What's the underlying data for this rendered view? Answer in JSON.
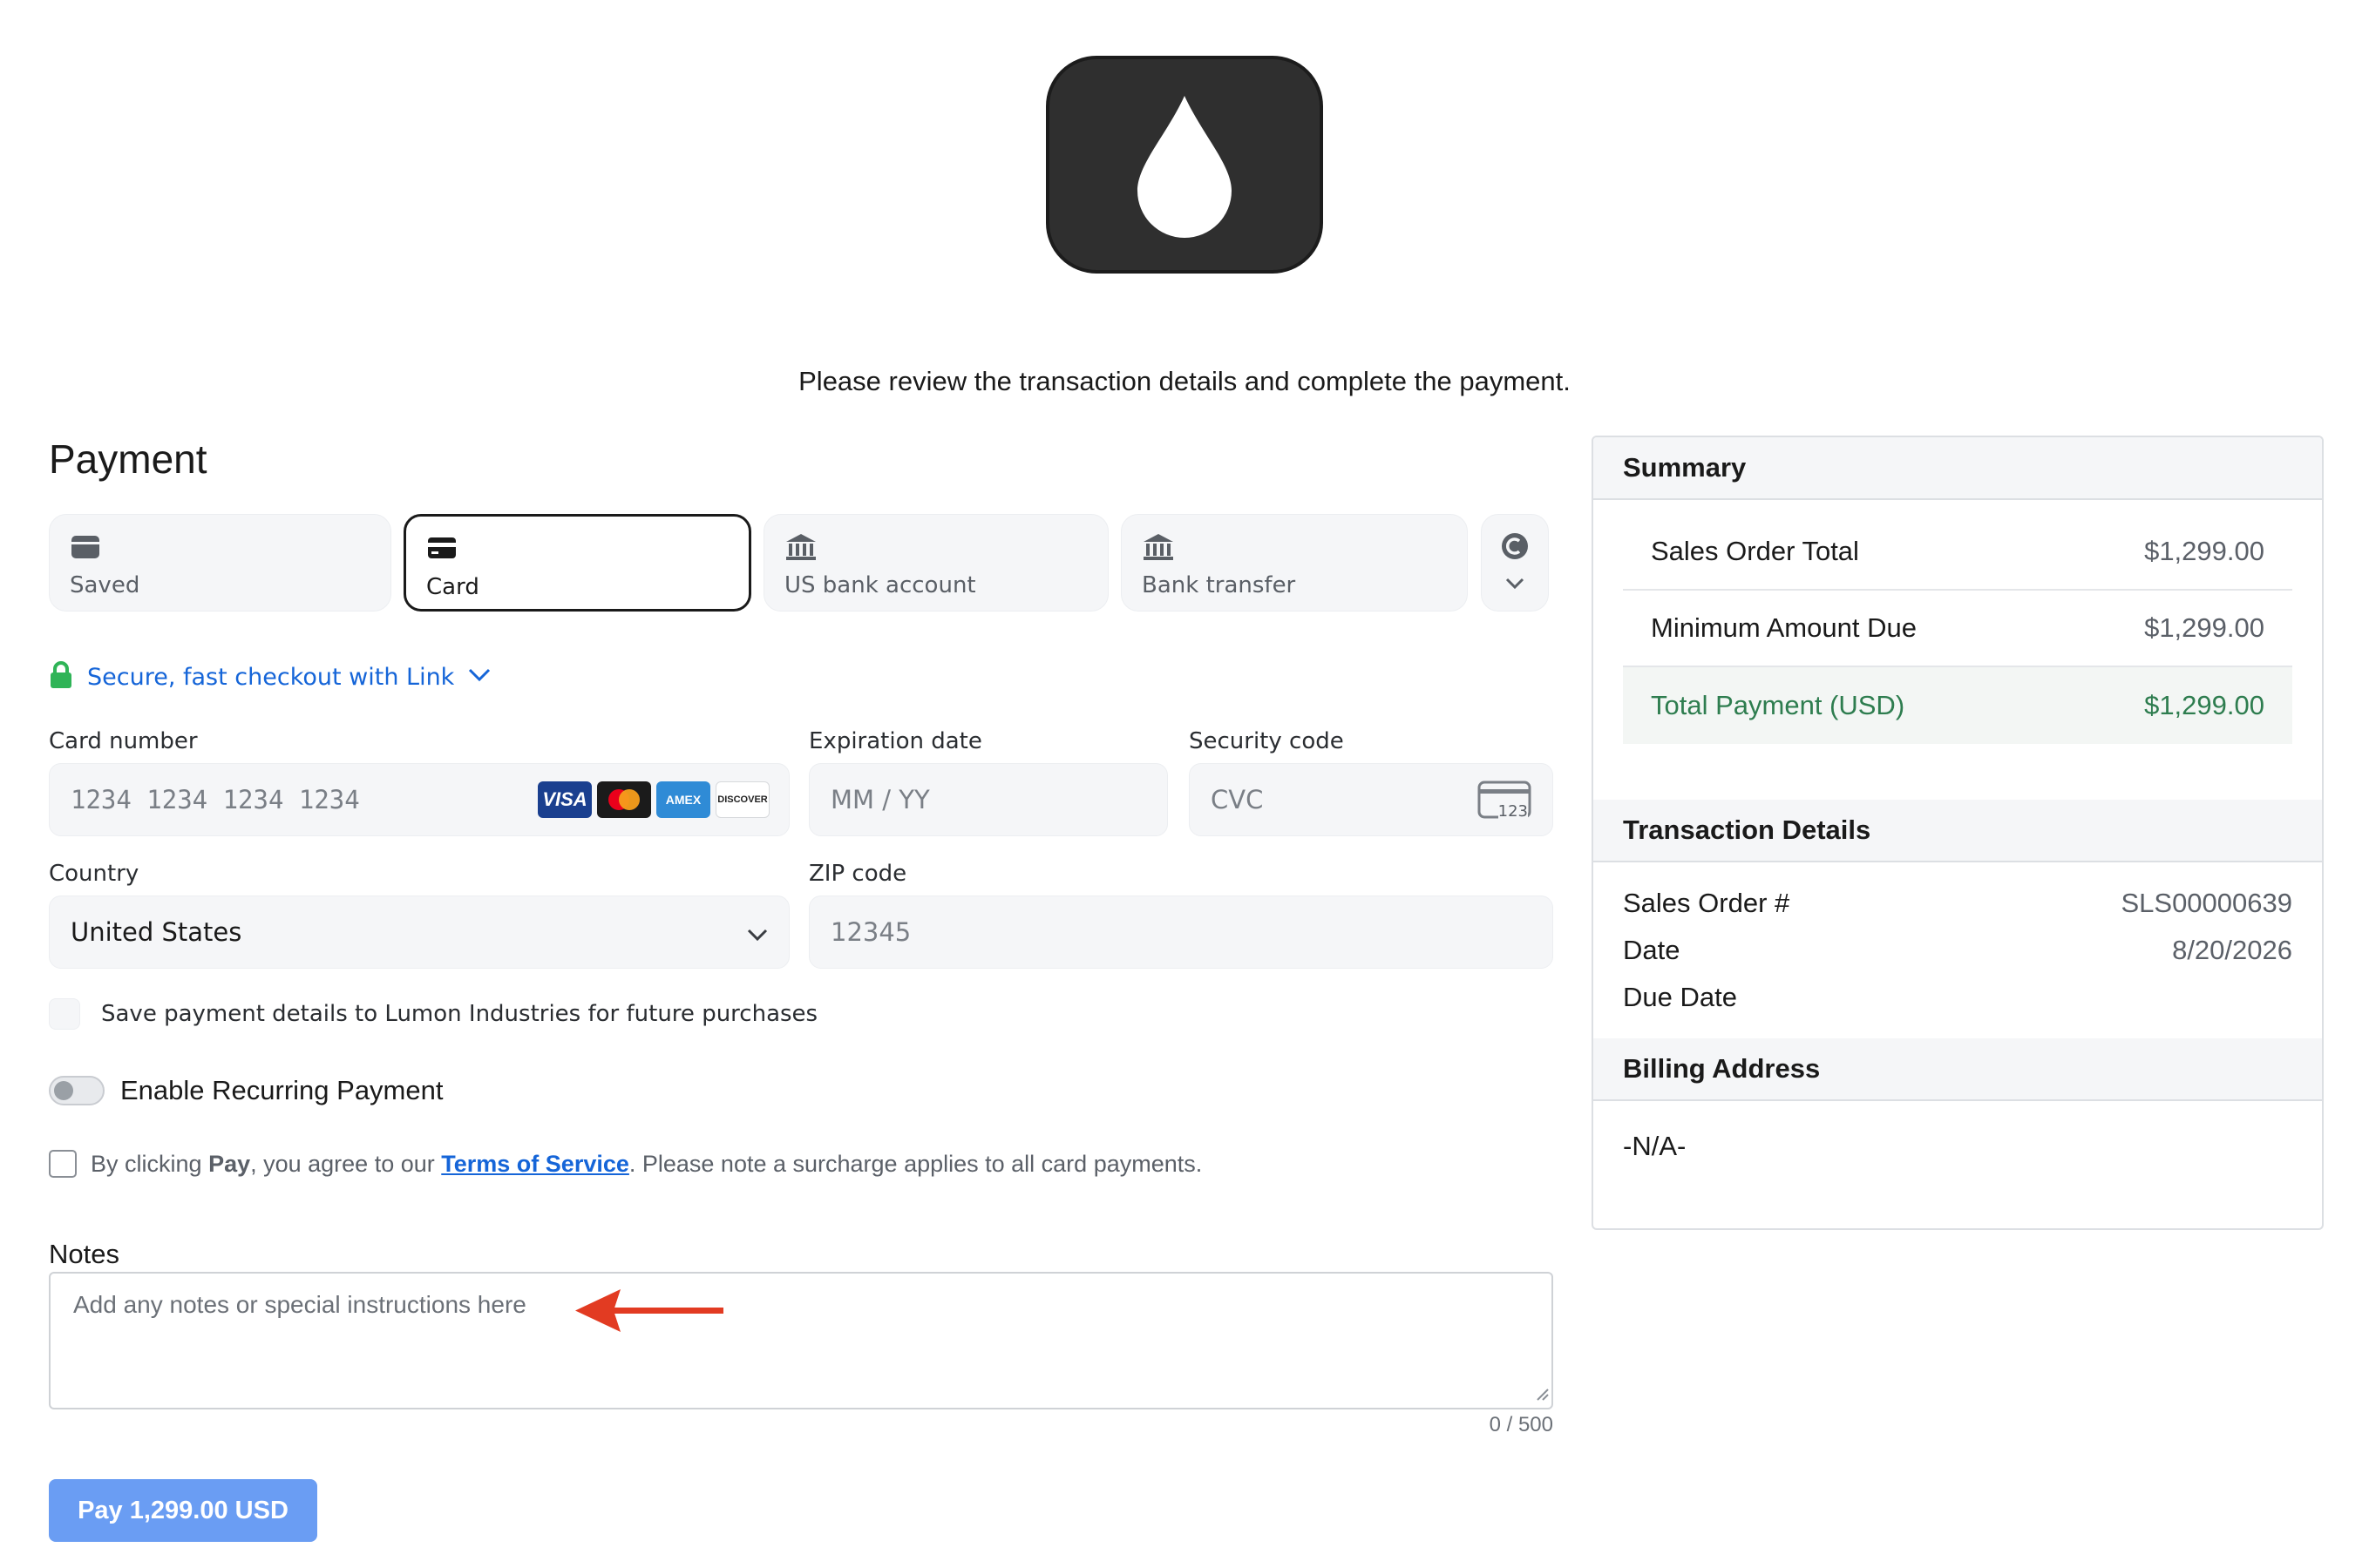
{
  "intro_text": "Please review the transaction details and complete the payment.",
  "payment": {
    "title": "Payment",
    "tabs": [
      {
        "label": "Saved",
        "icon": "wallet-icon"
      },
      {
        "label": "Card",
        "icon": "card-icon",
        "active": true
      },
      {
        "label": "US bank account",
        "icon": "bank-icon"
      },
      {
        "label": "Bank transfer",
        "icon": "bank-icon"
      }
    ],
    "more_tab_icon": "currency-icon",
    "link_text": "Secure, fast checkout with Link",
    "card_number": {
      "label": "Card number",
      "placeholder": "1234 1234 1234 1234",
      "brands": [
        "VISA",
        "Mastercard",
        "AMEX",
        "DISCOVER"
      ]
    },
    "expiration": {
      "label": "Expiration date",
      "placeholder": "MM / YY"
    },
    "security": {
      "label": "Security code",
      "placeholder": "CVC",
      "icon_text": "123"
    },
    "country": {
      "label": "Country",
      "value": "United States"
    },
    "zip": {
      "label": "ZIP code",
      "placeholder": "12345"
    },
    "save_text": "Save payment details to Lumon Industries for future purchases",
    "recurring_text": "Enable Recurring Payment",
    "tos": {
      "prefix": "By clicking",
      "bold": "Pay",
      "middle": ", you agree to our",
      "link": "Terms of Service",
      "suffix": ". Please note a surcharge applies to all card payments."
    },
    "notes": {
      "label": "Notes",
      "placeholder": "Add any notes or special instructions here",
      "counter": "0 / 500"
    },
    "pay_button": "Pay 1,299.00 USD"
  },
  "summary": {
    "title": "Summary",
    "rows": [
      {
        "label": "Sales Order Total",
        "amount": "$1,299.00"
      },
      {
        "label": "Minimum Amount Due",
        "amount": "$1,299.00"
      },
      {
        "label": "Total Payment (USD)",
        "amount": "$1,299.00"
      }
    ]
  },
  "transaction": {
    "title": "Transaction Details",
    "rows": [
      {
        "label": "Sales Order #",
        "value": "SLS00000639"
      },
      {
        "label": "Date",
        "value": "8/20/2026"
      },
      {
        "label": "Due Date",
        "value": ""
      }
    ]
  },
  "billing": {
    "title": "Billing Address",
    "value": "-N/A-"
  },
  "colors": {
    "link_blue": "#1565d8",
    "pay_button": "#6a9df3",
    "total_green": "#2e7d4f",
    "lock_green": "#2fb457",
    "annotation_arrow": "#e23b22"
  }
}
